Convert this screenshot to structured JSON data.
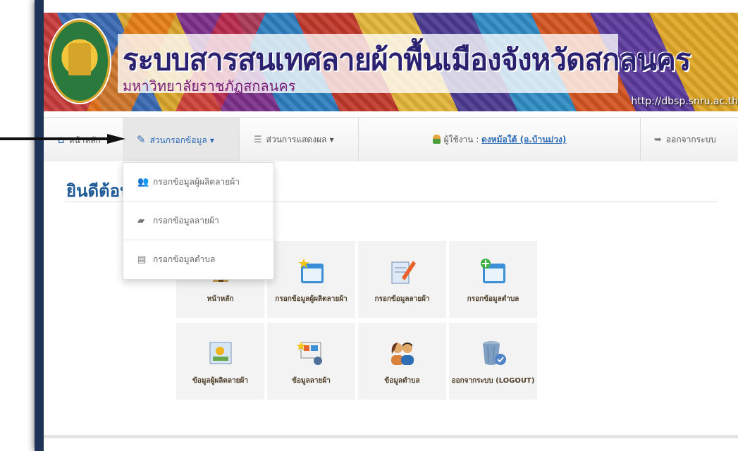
{
  "banner": {
    "title": "ระบบสารสนเทศลายผ้าพื้นเมืองจังหวัดสกลนคร",
    "subtitle": "มหาวิทยาลัยราชภัฏสกลนคร",
    "url": "http://dbsp.snru.ac.th"
  },
  "nav": {
    "home_label": "หน้าหลัก",
    "input_label": "ส่วนกรอกข้อมูล",
    "display_label": "ส่วนการแสดงผล",
    "user_prefix": "ผู้ใช้งาน : ",
    "user_name": "ดงหม้อใต้ (อ.บ้านม่วง)",
    "logout_label": "ออกจากระบบ"
  },
  "dropdown": {
    "items": [
      {
        "label": "กรอกข้อมูลผู้ผลิตลายผ้า",
        "icon": "group-icon"
      },
      {
        "label": "กรอกข้อมูลลายผ้า",
        "icon": "book-icon"
      },
      {
        "label": "กรอกข้อมูลตำบล",
        "icon": "building-icon"
      }
    ]
  },
  "main": {
    "welcome": "ยินดีต้อนรับ",
    "tiles": [
      {
        "label": "หน้าหลัก",
        "icon": "home-icon"
      },
      {
        "label": "กรอกข้อมูลผู้ผลิตลายผ้า",
        "icon": "window-star-icon"
      },
      {
        "label": "กรอกข้อมูลลายผ้า",
        "icon": "edit-document-icon"
      },
      {
        "label": "กรอกข้อมูลตำบล",
        "icon": "window-add-icon"
      },
      {
        "label": "ข้อมูลผู้ผลิตลายผ้า",
        "icon": "picture-icon"
      },
      {
        "label": "ข้อมูลลายผ้า",
        "icon": "presentation-icon"
      },
      {
        "label": "ข้อมูลตำบล",
        "icon": "users-icon"
      },
      {
        "label": "ออกจากระบบ (LOGOUT)",
        "icon": "recycle-bin-icon"
      }
    ]
  }
}
